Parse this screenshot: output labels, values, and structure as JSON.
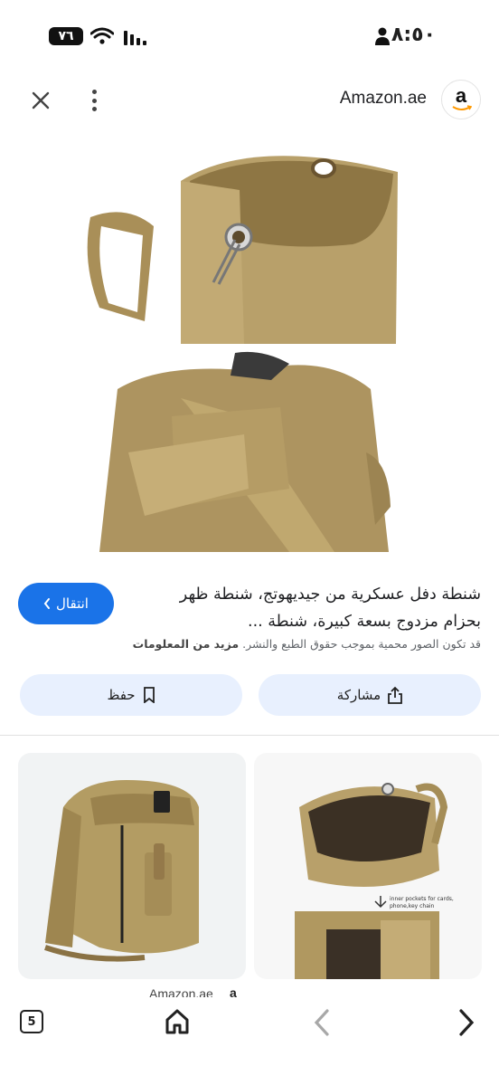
{
  "status_bar": {
    "time": "٨:٥٠",
    "battery": "٧٦"
  },
  "header": {
    "site_name": "Amazon.ae",
    "site_logo_letter": "a"
  },
  "result": {
    "title": "شنطة دفل عسكرية من جيديهوتج، شنطة ظهر بحزام مزدوج بسعة كبيرة، شنطة ...",
    "go_label": "انتقال",
    "copyright_notice": "قد تكون الصور محمية بموجب حقوق الطبع والنشر.",
    "more_info_label": "مزيد من المعلومات",
    "share_label": "مشاركة",
    "save_label": "حفظ",
    "inset_caption": "inner pockets for cards, phone,key chain"
  },
  "related": {
    "card_left_source": "Amazon.ae",
    "card_left_source_logo": "a"
  },
  "bottom_nav": {
    "tab_count": "5"
  },
  "colors": {
    "accent": "#1a73e8",
    "chip_bg": "#e8f0fe",
    "canvas": "#b59a62"
  }
}
